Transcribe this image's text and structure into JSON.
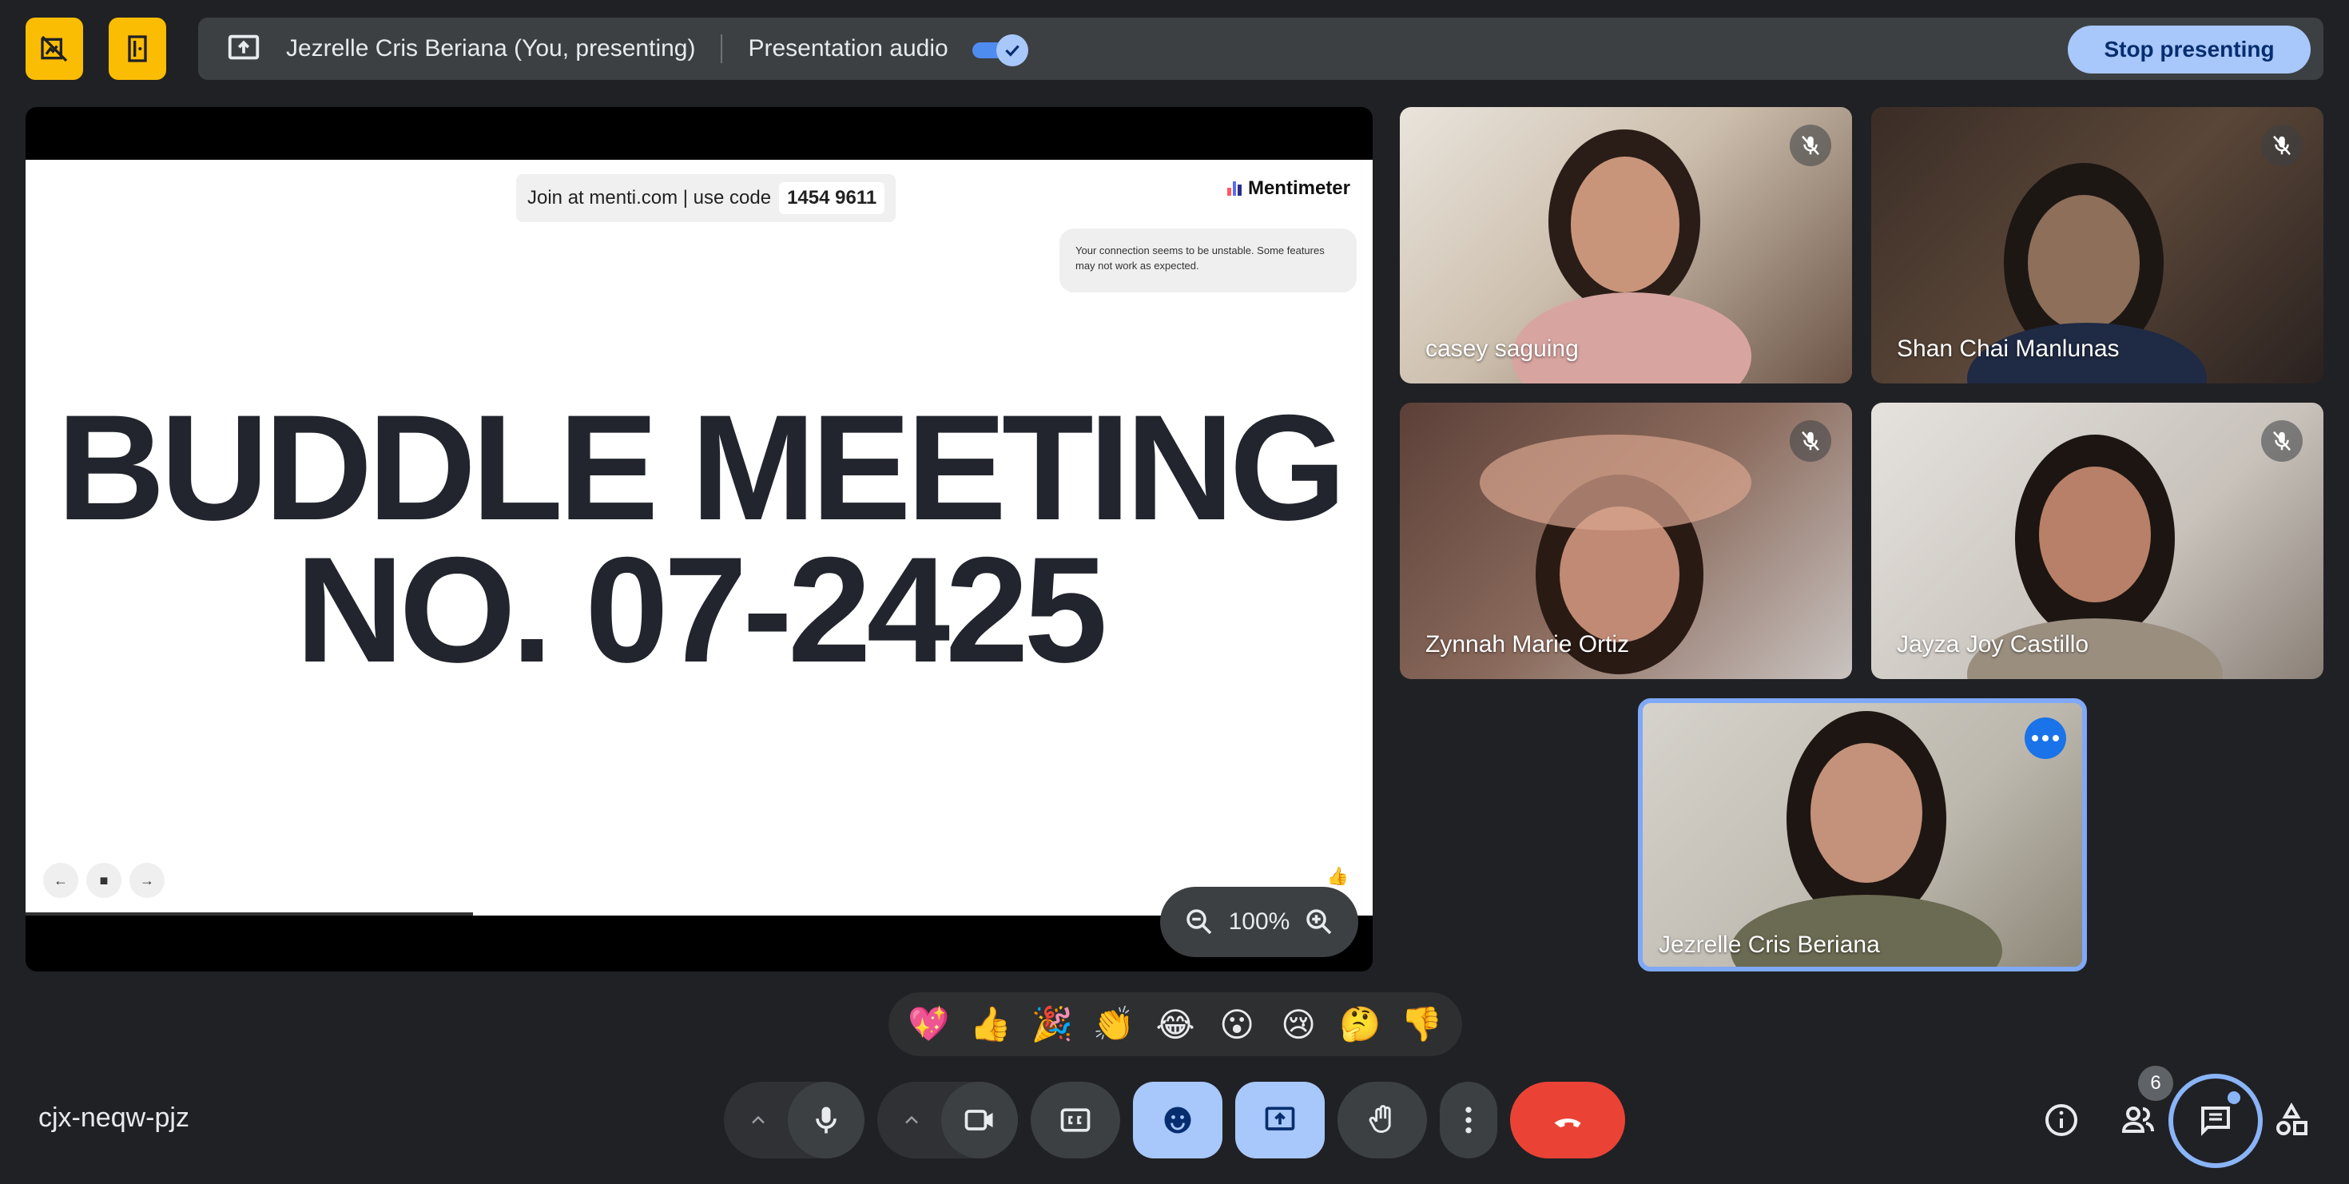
{
  "presenting_bar": {
    "presenter_text": "Jezrelle Cris Beriana (You, presenting)",
    "audio_label": "Presentation audio",
    "audio_enabled": true,
    "stop_label": "Stop presenting"
  },
  "slide": {
    "join_text": "Join at menti.com | use code",
    "join_code": "1454 9611",
    "brand": "Mentimeter",
    "notice": "Your connection seems to be unstable. Some features may not work as expected.",
    "headline_line1": "BUDDLE MEETING",
    "headline_line2": "NO. 07-2425"
  },
  "zoom": {
    "value": "100%"
  },
  "participants": [
    {
      "name": "casey saguing",
      "muted": true
    },
    {
      "name": "Shan Chai Manlunas",
      "muted": true
    },
    {
      "name": "Zynnah Marie Ortiz",
      "muted": true
    },
    {
      "name": "Jayza Joy Castillo",
      "muted": true
    },
    {
      "name": "Jezrelle Cris Beriana",
      "self": true
    }
  ],
  "reactions": [
    "💖",
    "👍",
    "🎉",
    "👏",
    "😂",
    "😮",
    "😢",
    "🤔",
    "👎"
  ],
  "meeting": {
    "code": "cjx-neqw-pjz",
    "participant_count": "6"
  },
  "colors": {
    "accent": "#a8c7fa",
    "end_call": "#ea4335",
    "warning": "#fbbc04",
    "bar_bg": "#3c4043"
  }
}
